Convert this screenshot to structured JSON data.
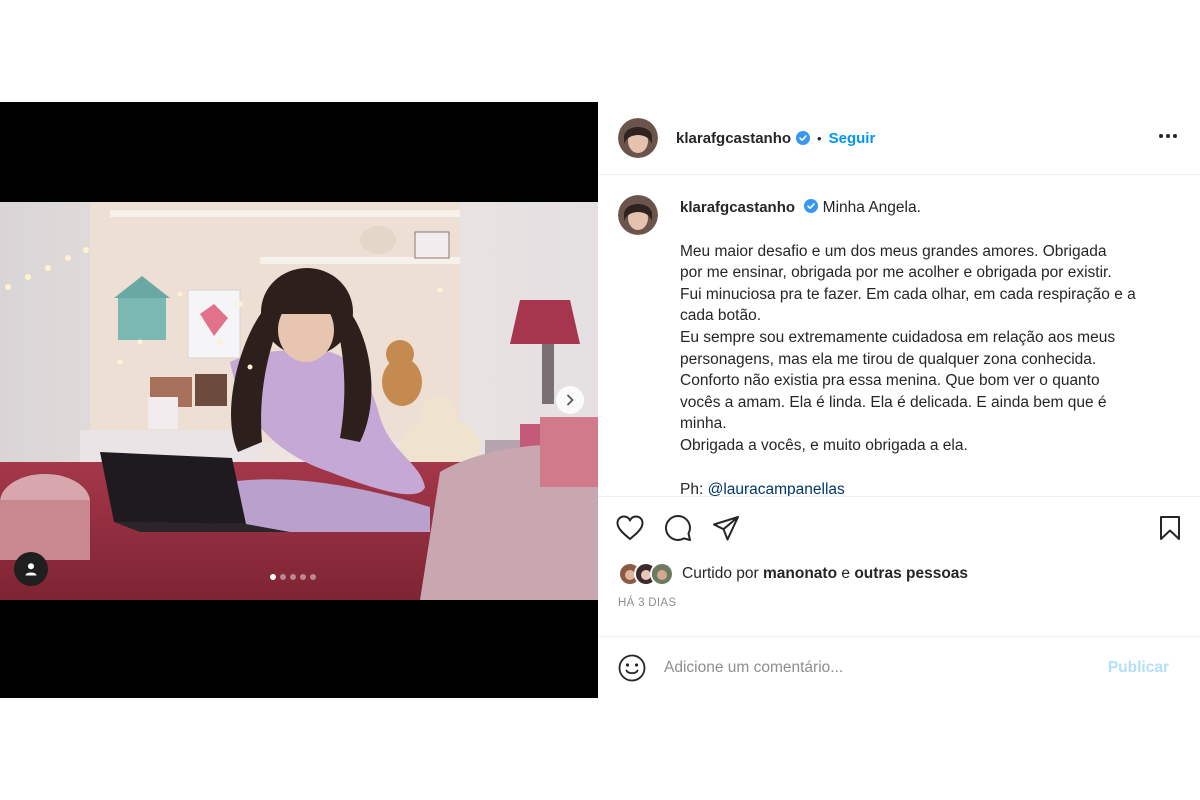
{
  "post": {
    "username": "klarafgcastanho",
    "verified_icon": "verified-badge-icon",
    "separator": "•",
    "follow_label": "Seguir",
    "more_icon": "more-options-icon"
  },
  "media": {
    "carousel": {
      "count": 5,
      "active_index": 0
    },
    "next_icon": "chevron-right-icon",
    "tag_icon": "user-tag-icon"
  },
  "caption": {
    "username": "klarafgcastanho",
    "title": "Minha Angela.",
    "lines": [
      "Meu maior desafio e um dos meus grandes amores. Obrigada",
      "por me ensinar, obrigada por me acolher e obrigada por existir.",
      "Fui minuciosa pra te fazer. Em cada olhar, em cada respiração e a",
      "cada botão.",
      "Eu sempre sou extremamente cuidadosa em relação aos meus",
      "personagens, mas ela me tirou de qualquer zona conhecida.",
      "Conforto não existia pra essa menina. Que bom ver o quanto",
      "vocês a amam. Ela é linda. Ela é delicada. E ainda bem que é",
      "minha.",
      "Obrigada a vocês, e muito obrigada a ela."
    ],
    "credit_prefix": "Ph:",
    "credit_mention": "@lauracampanellas"
  },
  "actions": {
    "like_icon": "heart-icon",
    "comment_icon": "comment-icon",
    "share_icon": "share-icon",
    "save_icon": "bookmark-icon"
  },
  "likes": {
    "prefix": "Curtido por",
    "user": "manonato",
    "conjunction": "e",
    "others": "outras pessoas"
  },
  "timestamp": "HÁ 3 DIAS",
  "comment": {
    "emoji_icon": "emoji-icon",
    "placeholder": "Adicione um comentário...",
    "publish_label": "Publicar"
  },
  "colors": {
    "accent": "#0095f6",
    "publish_disabled": "#b2dffc",
    "verified": "#3897f0",
    "muted": "#8e8e8e"
  }
}
